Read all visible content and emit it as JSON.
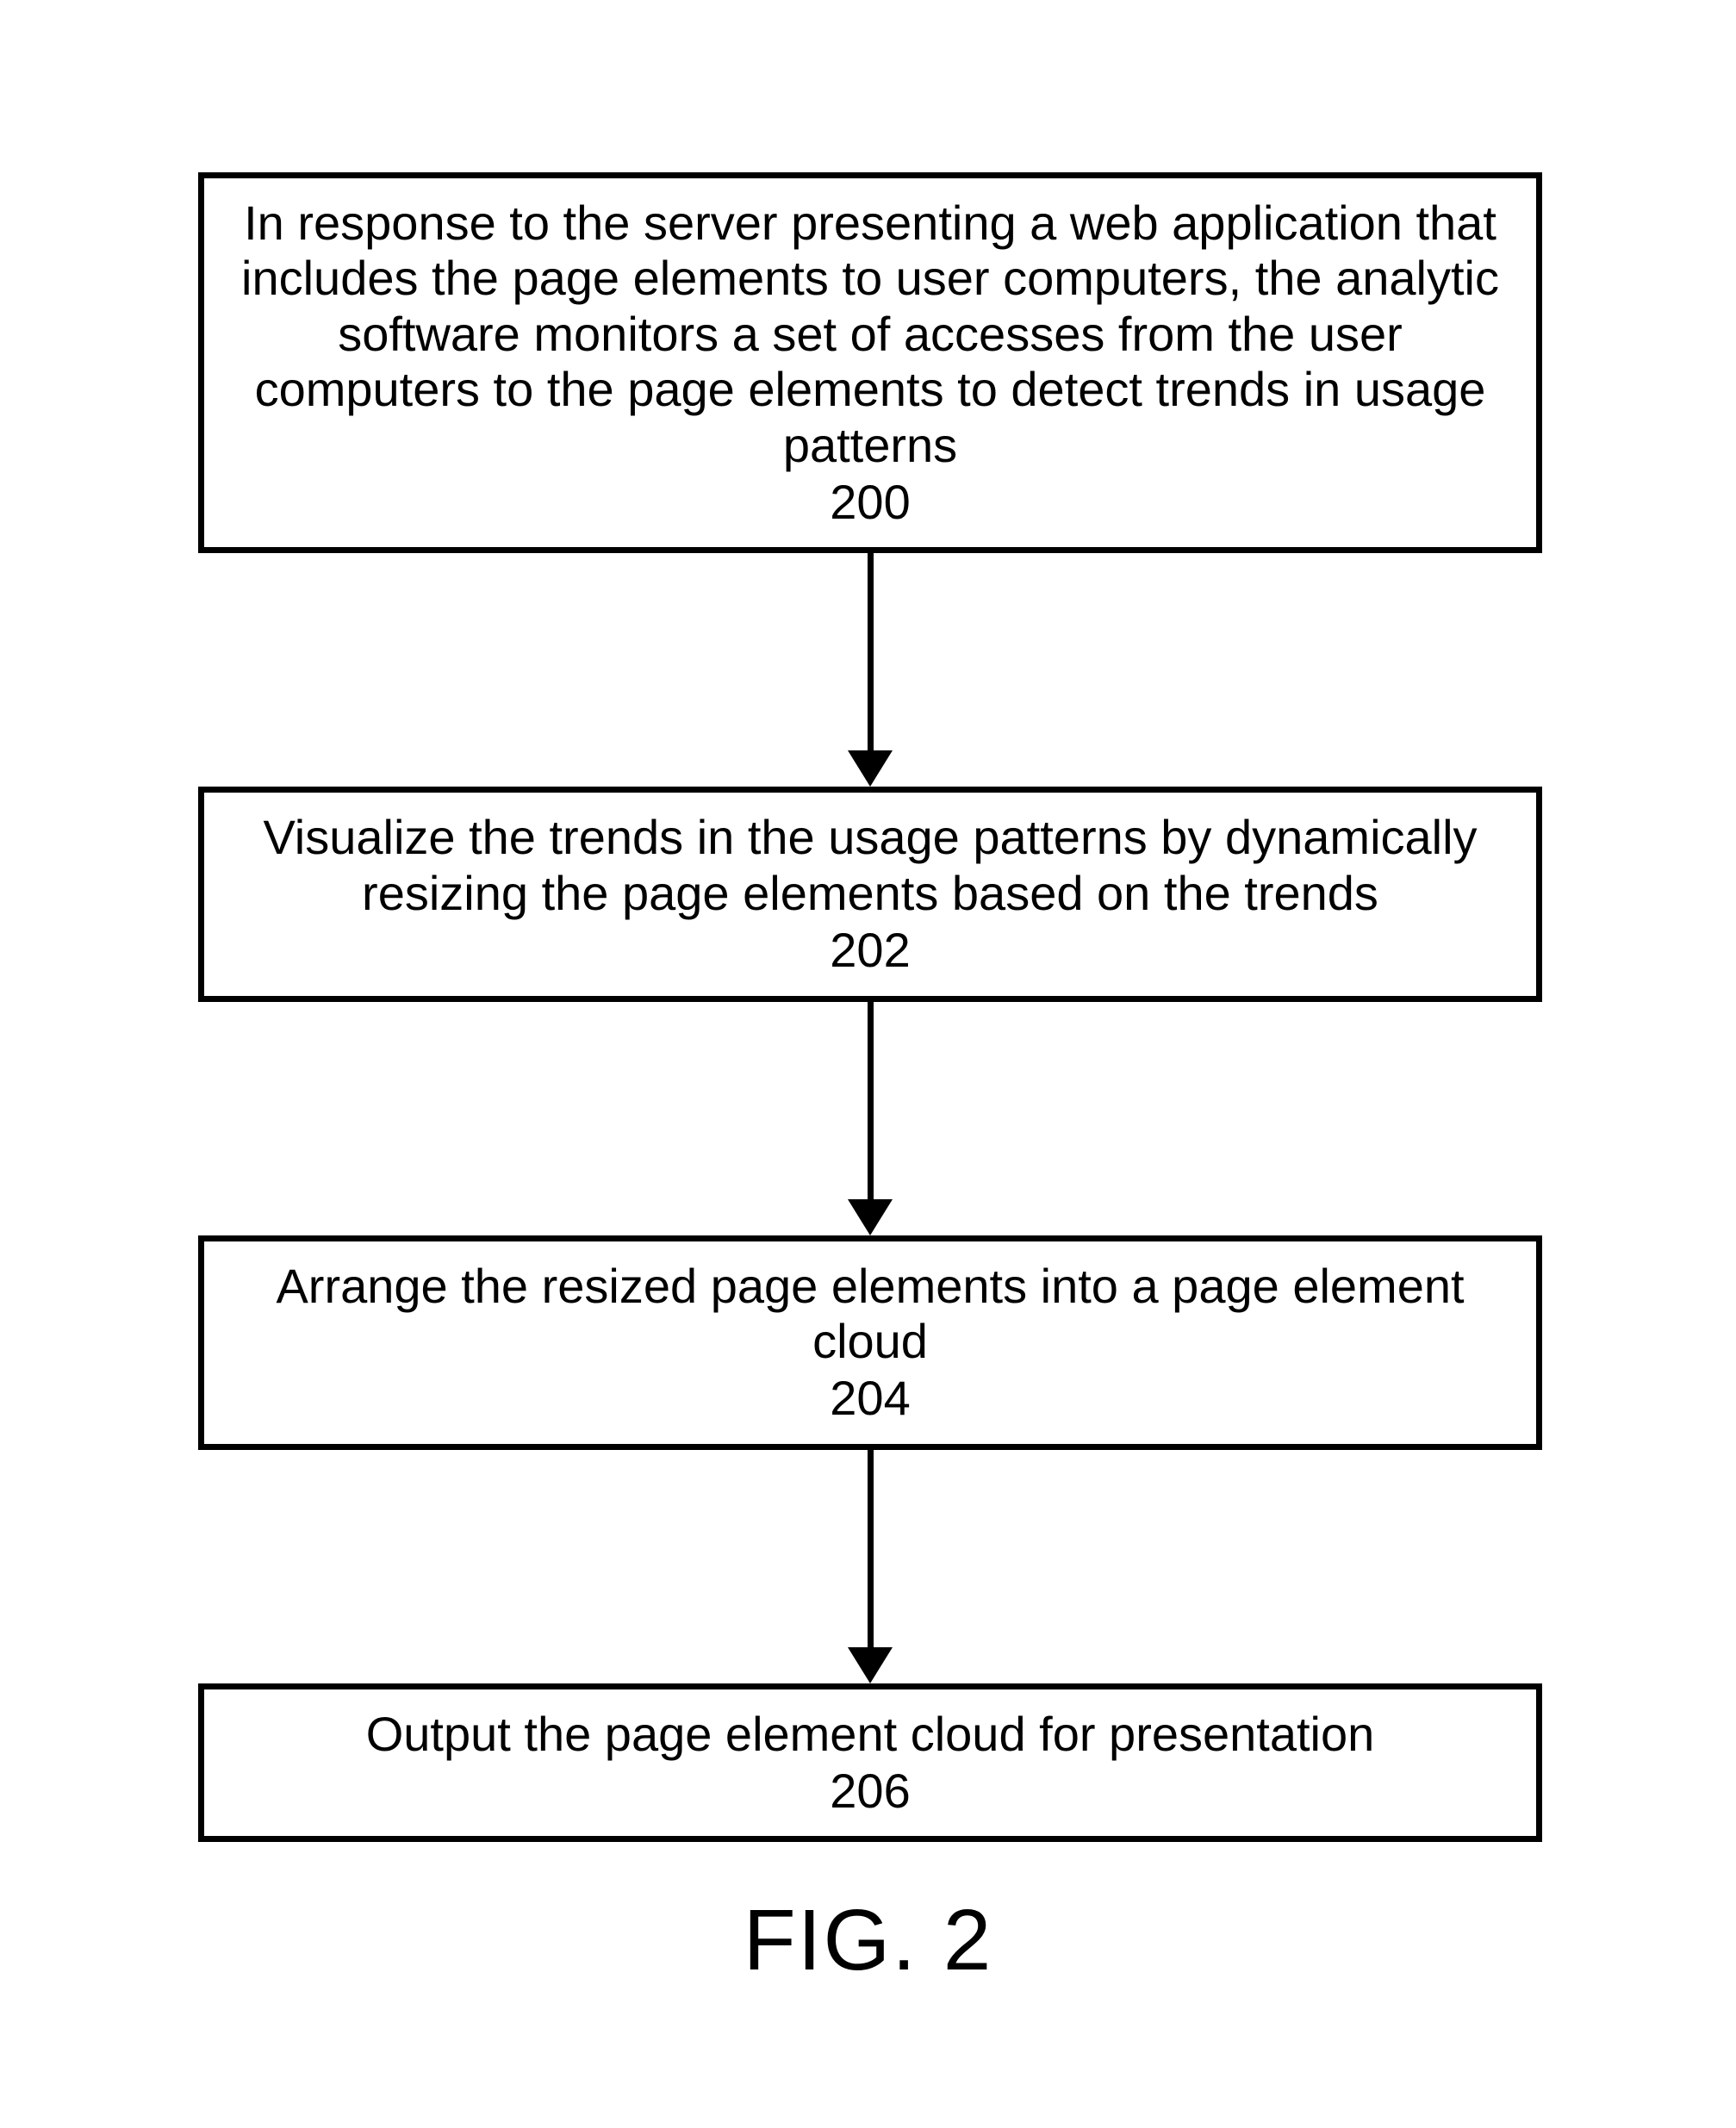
{
  "steps": [
    {
      "text": "In response to the server presenting a web application that includes the page elements to user computers, the analytic software monitors a set of accesses from the user computers to the page elements to detect trends in usage patterns",
      "num": "200"
    },
    {
      "text": "Visualize the trends in the usage patterns by dynamically resizing the page elements based on the trends",
      "num": "202"
    },
    {
      "text": "Arrange the resized page elements into a page element cloud",
      "num": "204"
    },
    {
      "text": "Output the page element cloud for presentation",
      "num": "206"
    }
  ],
  "figure_label": "FIG. 2"
}
